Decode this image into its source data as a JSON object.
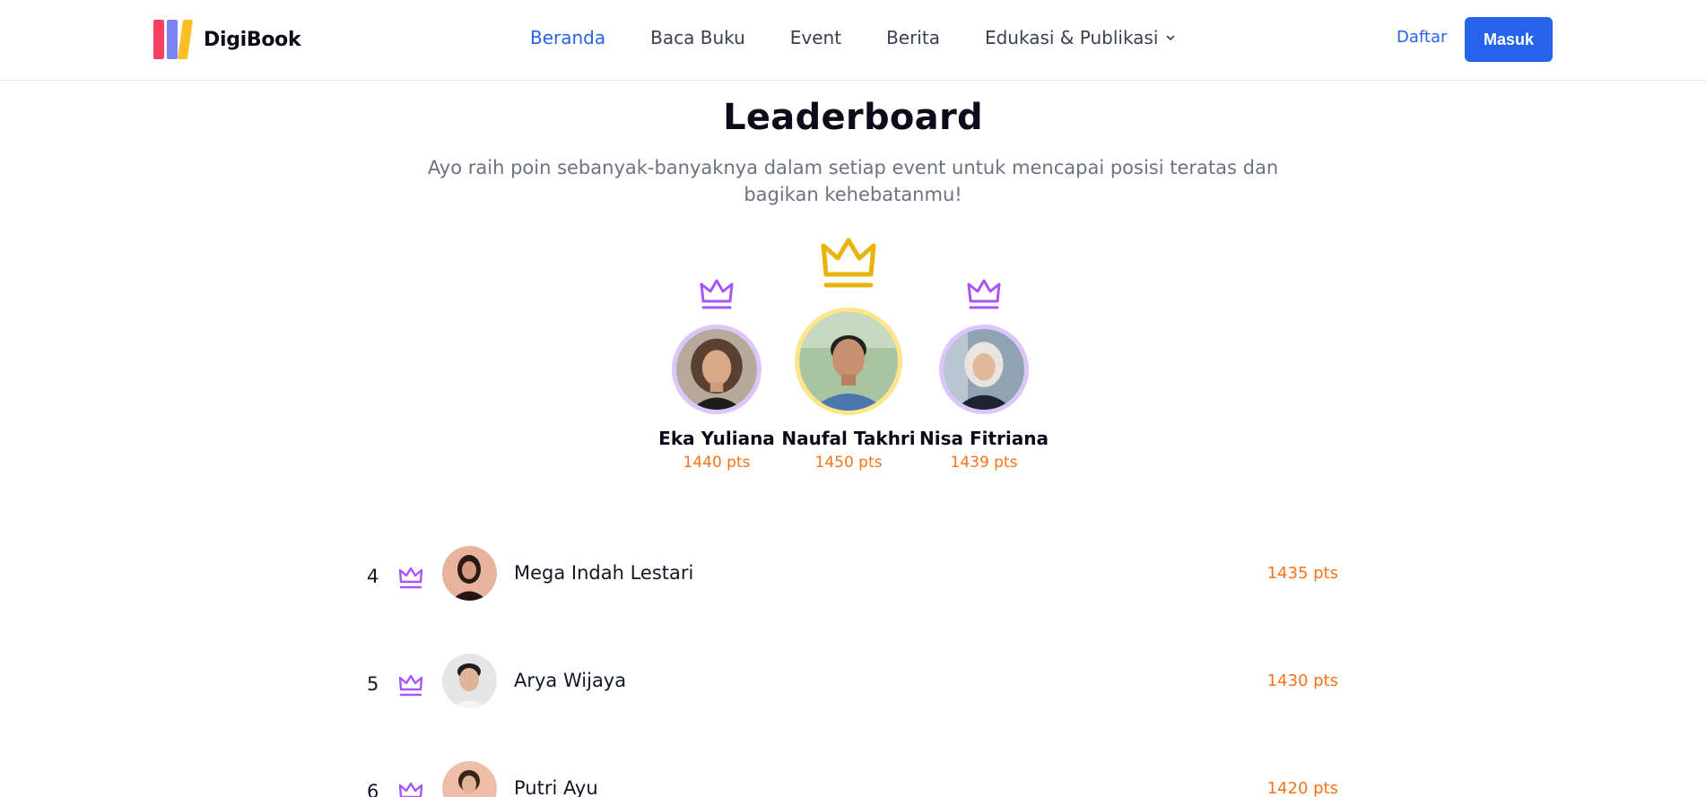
{
  "brand": {
    "name": "DigiBook"
  },
  "nav": {
    "items": [
      {
        "label": "Beranda",
        "active": true
      },
      {
        "label": "Baca Buku"
      },
      {
        "label": "Event"
      },
      {
        "label": "Berita"
      },
      {
        "label": "Edukasi & Publikasi",
        "dropdown": true
      }
    ]
  },
  "auth": {
    "register_label": "Daftar",
    "login_label": "Masuk"
  },
  "hero": {
    "title": "Leaderboard",
    "subtitle": "Ayo raih poin sebanyak-banyaknya dalam setiap event untuk mencapai posisi teratas dan bagikan kehebatanmu!"
  },
  "podium": {
    "first": {
      "name": "Naufal Takhri",
      "points": "1450 pts"
    },
    "second": {
      "name": "Eka Yuliana",
      "points": "1440 pts"
    },
    "third": {
      "name": "Nisa Fitriana",
      "points": "1439 pts"
    }
  },
  "ranking": [
    {
      "rank": "4",
      "name": "Mega Indah Lestari",
      "points": "1435 pts"
    },
    {
      "rank": "5",
      "name": "Arya Wijaya",
      "points": "1430 pts"
    },
    {
      "rank": "6",
      "name": "Putri Ayu",
      "points": "1420 pts"
    }
  ],
  "colors": {
    "accent": "#2563eb",
    "points": "#f97316",
    "crown_gold": "#eab308",
    "crown_purple": "#a855f7"
  }
}
